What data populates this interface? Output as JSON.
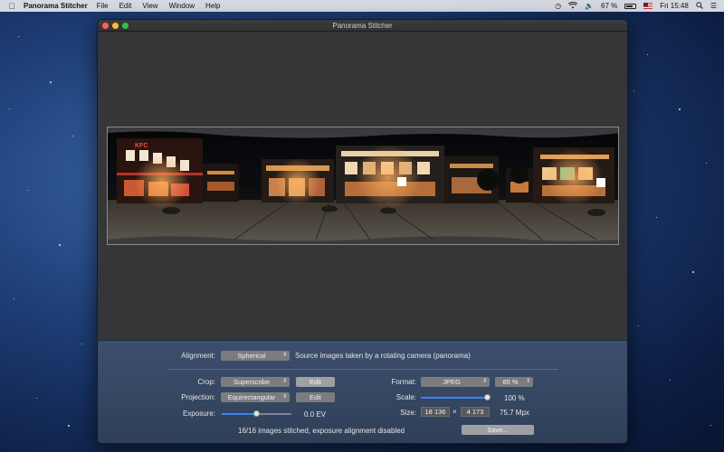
{
  "menubar": {
    "app_name": "Panorama Stitcher",
    "items": [
      "File",
      "Edit",
      "View",
      "Window",
      "Help"
    ],
    "battery_percent": "67 %",
    "clock": "Fri 15:48"
  },
  "window": {
    "title": "Panorama Stitcher"
  },
  "controls": {
    "alignment_label": "Alignment:",
    "alignment_value": "Spherical",
    "alignment_description": "Source images taken by a rotating camera (panorama)",
    "crop_label": "Crop:",
    "crop_value": "Superscribe",
    "crop_edit": "Edit",
    "projection_label": "Projection:",
    "projection_value": "Equirectangular",
    "projection_edit": "Edit",
    "exposure_label": "Exposure:",
    "exposure_value": "0.0 EV",
    "exposure_level": 0.5,
    "format_label": "Format:",
    "format_value": "JPEG",
    "quality_value": "85 %",
    "scale_label": "Scale:",
    "scale_value": "100 %",
    "scale_level": 1.0,
    "size_label": "Size:",
    "size_width": "18 136",
    "size_times": "×",
    "size_height": "4 173",
    "size_mpx": "75.7 Mpx",
    "status": "16/16 images stitched, exposure alignment disabled",
    "save_label": "Save..."
  },
  "colors": {
    "accent": "#3b82f6",
    "panel": "#3c4e6c",
    "window_bg": "#2e2f31"
  }
}
